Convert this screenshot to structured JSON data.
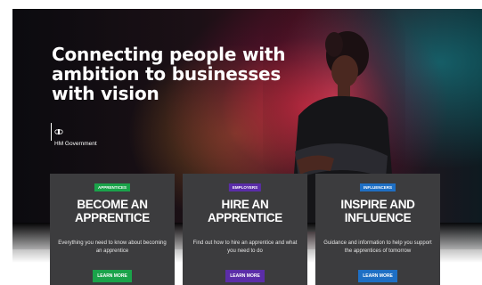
{
  "hero": {
    "headline": "Connecting people with ambition to businesses with vision",
    "gov_logo_text": "HM Government"
  },
  "cards": [
    {
      "badge": "APPRENTICES",
      "badge_color": "#1aa34a",
      "title": "BECOME AN APPRENTICE",
      "description": "Everything you need to know about becoming an apprentice",
      "button": "LEARN MORE",
      "button_color": "#1aa34a"
    },
    {
      "badge": "EMPLOYERS",
      "badge_color": "#5b2da8",
      "title": "HIRE AN APPRENTICE",
      "description": "Find out how to hire an apprentice and what you need to do",
      "button": "LEARN MORE",
      "button_color": "#5b2da8"
    },
    {
      "badge": "INFLUENCERS",
      "badge_color": "#1e6fc4",
      "title": "INSPIRE AND INFLUENCE",
      "description": "Guidance and information to help you support the apprentices of tomorrow",
      "button": "LEARN MORE",
      "button_color": "#1e6fc4"
    }
  ]
}
